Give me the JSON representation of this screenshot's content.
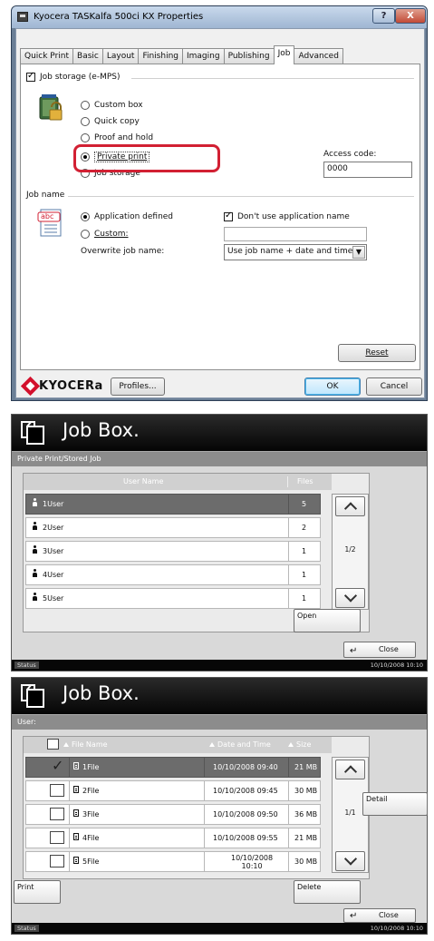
{
  "dialog": {
    "title": "Kyocera TASKalfa 500ci KX Properties",
    "help_label": "?",
    "close_label": "X",
    "tabs": [
      "Quick Print",
      "Basic",
      "Layout",
      "Finishing",
      "Imaging",
      "Publishing",
      "Job",
      "Advanced"
    ],
    "active_tab": "Job",
    "job_storage_label": "Job storage (e-MPS)",
    "job_storage_checked": true,
    "storage_options": [
      "Custom box",
      "Quick copy",
      "Proof and hold",
      "Private print",
      "Job storage"
    ],
    "storage_selected": "Private print",
    "access_code_label": "Access code:",
    "access_code_value": "0000",
    "job_name_section": "Job name",
    "name_options": [
      "Application defined",
      "Custom:"
    ],
    "name_selected": "Application defined",
    "dont_use_app_name_label": "Don't use application name",
    "dont_use_app_name_checked": true,
    "custom_name_value": "",
    "overwrite_label": "Overwrite job name:",
    "overwrite_value": "Use job name + date and time",
    "doc_icon_text": "abc",
    "reset_label": "Reset",
    "brand_name": "KYOCERa",
    "profiles_label": "Profiles...",
    "ok_label": "OK",
    "cancel_label": "Cancel"
  },
  "screen1": {
    "title": "Job Box.",
    "subtitle": "Private Print/Stored Job",
    "col_user": "User Name",
    "col_files": "Files",
    "users": [
      {
        "name": "1User",
        "files": "5",
        "selected": true
      },
      {
        "name": "2User",
        "files": "2",
        "selected": false
      },
      {
        "name": "3User",
        "files": "1",
        "selected": false
      },
      {
        "name": "4User",
        "files": "1",
        "selected": false
      },
      {
        "name": "5User",
        "files": "1",
        "selected": false
      }
    ],
    "page_indicator": "1/2",
    "open_label": "Open",
    "close_label": "Close",
    "status_label": "Status",
    "datetime": "10/10/2008   10:10"
  },
  "screen2": {
    "title": "Job Box.",
    "subtitle": "User:",
    "col_file": "File Name",
    "col_date": "Date and Time",
    "col_size": "Size",
    "files": [
      {
        "name": "1File",
        "date": "10/10/2008 09:40",
        "size": "21 MB",
        "checked": true,
        "selected": true
      },
      {
        "name": "2File",
        "date": "10/10/2008 09:45",
        "size": "30 MB",
        "checked": false,
        "selected": false
      },
      {
        "name": "3File",
        "date": "10/10/2008 09:50",
        "size": "36 MB",
        "checked": false,
        "selected": false
      },
      {
        "name": "4File",
        "date": "10/10/2008 09:55",
        "size": "21 MB",
        "checked": false,
        "selected": false
      },
      {
        "name": "5File",
        "date_line1": "10/10/2008",
        "date_line2": "10:10",
        "size": "30 MB",
        "checked": false,
        "selected": false
      }
    ],
    "page_indicator": "1/1",
    "detail_label": "Detail",
    "print_label": "Print",
    "delete_label": "Delete",
    "close_label": "Close",
    "status_label": "Status",
    "datetime": "10/10/2008   10:10"
  },
  "colors": {
    "highlight_red": "#d22033",
    "brand_red": "#d3102c",
    "panel_bg": "#d9d9d9",
    "selected_row": "#6c6c6c"
  }
}
